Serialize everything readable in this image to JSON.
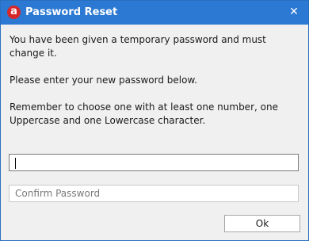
{
  "window": {
    "title": "Password Reset",
    "app_icon_glyph": "a",
    "close_glyph": "✕",
    "colors": {
      "titlebar": "#2b79d2",
      "app_icon": "#d6282b"
    }
  },
  "message": {
    "line1": "You have been given a temporary password and must change it.",
    "line2": "Please enter your new password below.",
    "line3": "Remember to choose one with at least one number, one Uppercase and one Lowercase character."
  },
  "form": {
    "new_password": {
      "value": "",
      "placeholder": ""
    },
    "confirm_password": {
      "value": "",
      "placeholder": "Confirm Password"
    },
    "ok_label": "Ok"
  }
}
